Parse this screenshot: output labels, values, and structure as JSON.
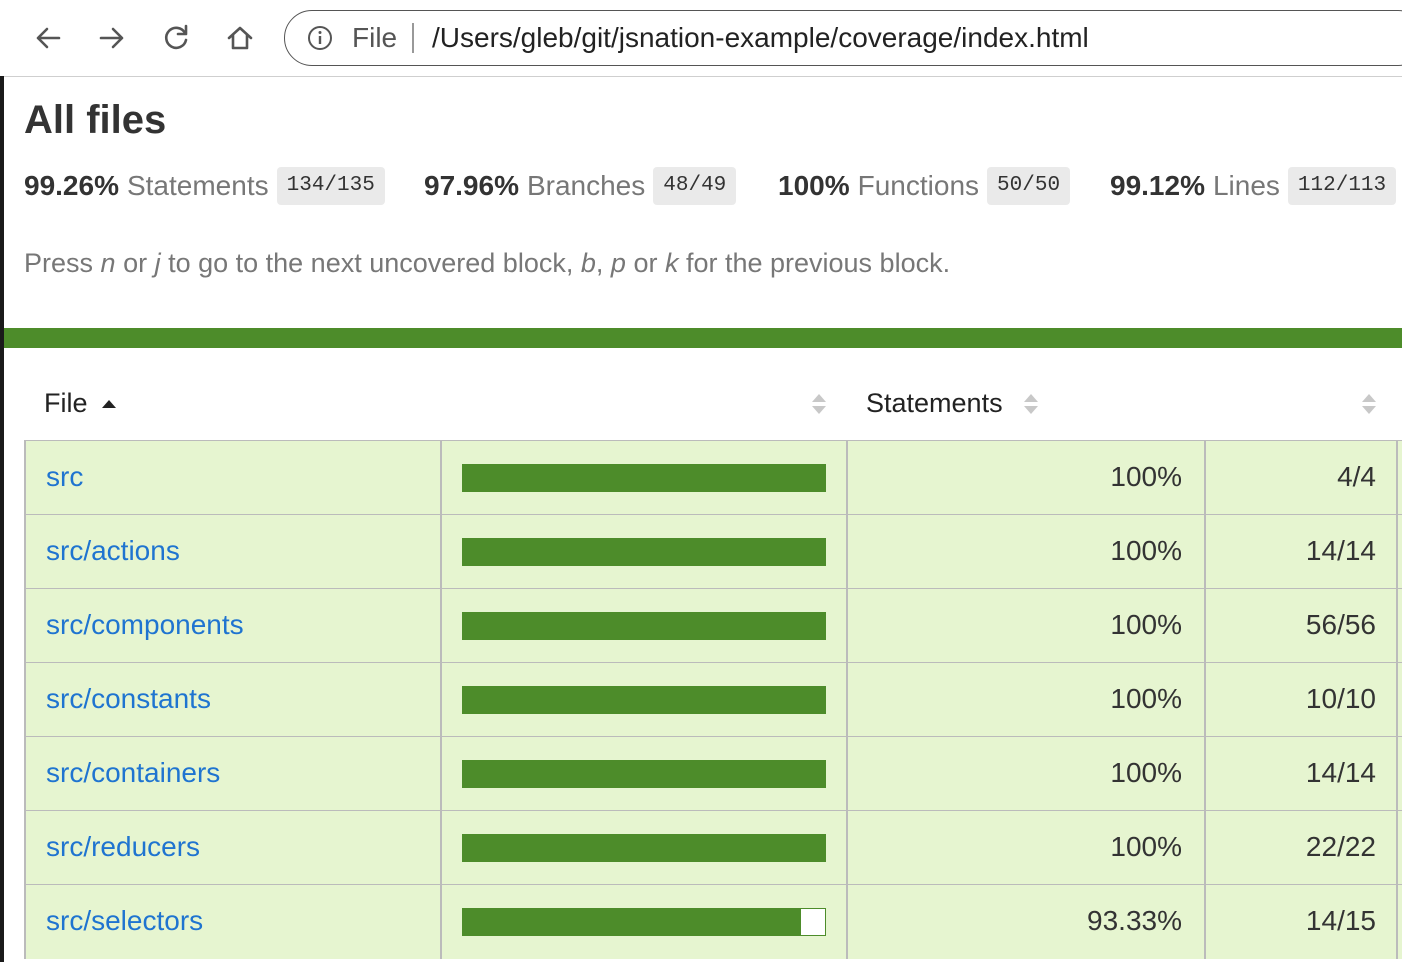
{
  "browser": {
    "scheme_label": "File",
    "url": "/Users/gleb/git/jsnation-example/coverage/index.html"
  },
  "page": {
    "title": "All files",
    "summary": [
      {
        "pct": "99.26%",
        "label": "Statements",
        "fraction": "134/135"
      },
      {
        "pct": "97.96%",
        "label": "Branches",
        "fraction": "48/49"
      },
      {
        "pct": "100%",
        "label": "Functions",
        "fraction": "50/50"
      },
      {
        "pct": "99.12%",
        "label": "Lines",
        "fraction": "112/113"
      }
    ],
    "hint": {
      "t1": "Press ",
      "k1": "n",
      "t2": " or ",
      "k2": "j",
      "t3": " to go to the next uncovered block, ",
      "k3": "b",
      "t4": ", ",
      "k4": "p",
      "t5": " or ",
      "k5": "k",
      "t6": " for the previous block."
    },
    "status_color": "#4d8c2a"
  },
  "table": {
    "headers": {
      "file": "File",
      "statements": "Statements"
    },
    "rows": [
      {
        "file": "src",
        "coverage": 1.0,
        "pct": "100%",
        "fraction": "4/4"
      },
      {
        "file": "src/actions",
        "coverage": 1.0,
        "pct": "100%",
        "fraction": "14/14"
      },
      {
        "file": "src/components",
        "coverage": 1.0,
        "pct": "100%",
        "fraction": "56/56"
      },
      {
        "file": "src/constants",
        "coverage": 1.0,
        "pct": "100%",
        "fraction": "10/10"
      },
      {
        "file": "src/containers",
        "coverage": 1.0,
        "pct": "100%",
        "fraction": "14/14"
      },
      {
        "file": "src/reducers",
        "coverage": 1.0,
        "pct": "100%",
        "fraction": "22/22"
      },
      {
        "file": "src/selectors",
        "coverage": 0.9333,
        "pct": "93.33%",
        "fraction": "14/15"
      }
    ]
  }
}
